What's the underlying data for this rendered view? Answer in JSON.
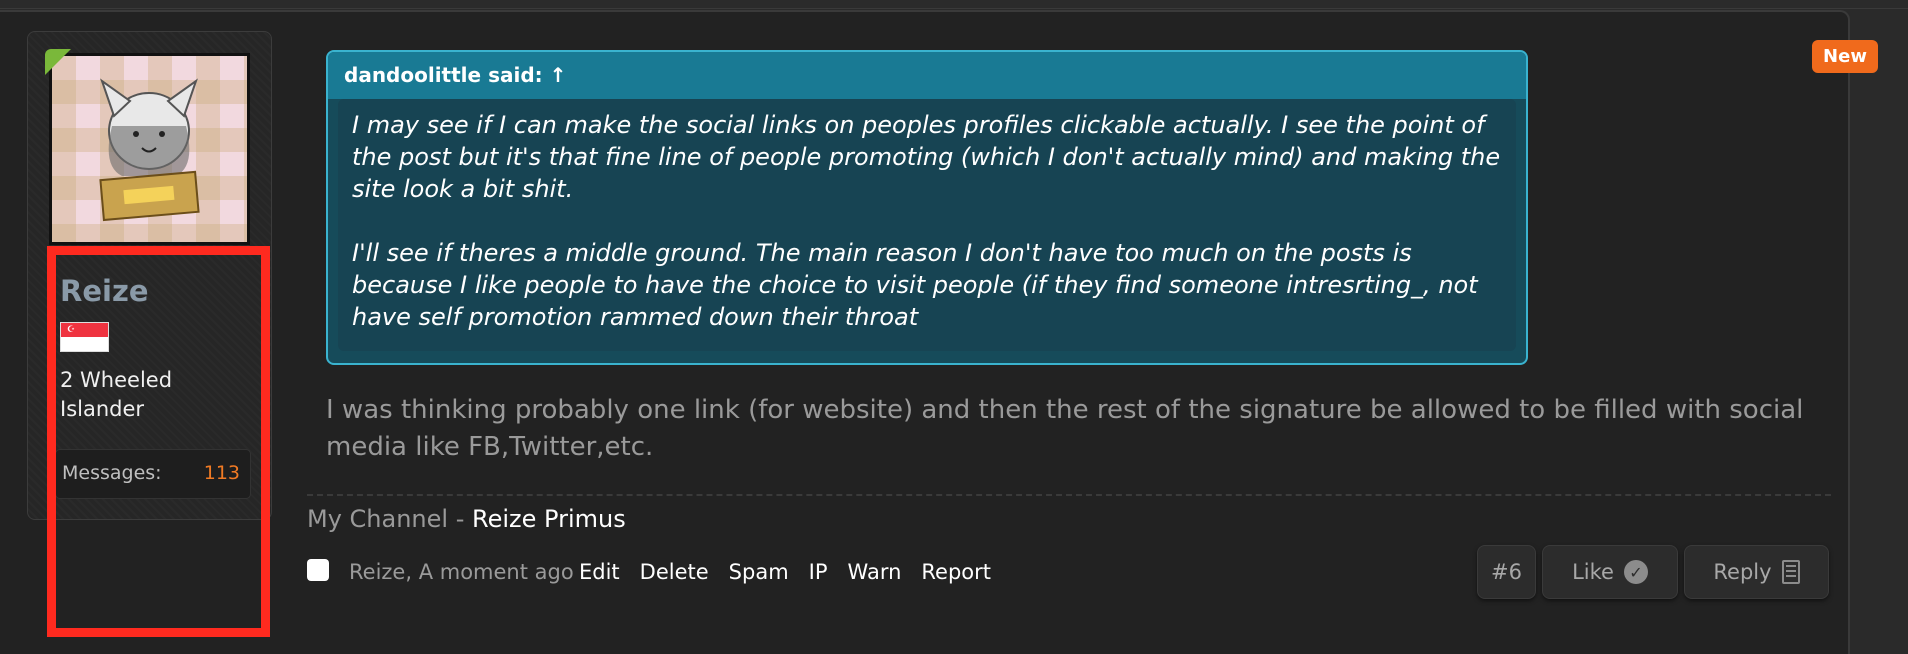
{
  "badge": {
    "new_label": "New"
  },
  "user": {
    "name": "Reize",
    "flag_icon": "singapore-flag-icon",
    "title": "2 Wheeled Islander",
    "stats": {
      "messages_label": "Messages:",
      "messages_value": "113"
    }
  },
  "quote": {
    "header": "dandoolittle said: ↑",
    "paragraphs": [
      "I may see if I can make the social links on peoples profiles clickable actually. I see the point of the post but it's that fine line of people promoting (which I don't actually mind) and making the site look a bit shit.",
      "I'll see if theres a middle ground. The main reason I don't have too much on the posts is because I like people to have the choice to visit people (if they find someone intresrting_, not have self promotion rammed down their throat"
    ]
  },
  "message": {
    "body": "I was thinking probably one link (for website) and then the rest of the signature be allowed to be filled with social media like FB,Twitter,etc."
  },
  "signature": {
    "prefix": "My Channel - ",
    "link": "Reize Primus"
  },
  "meta": {
    "author_time": "Reize, A moment ago"
  },
  "actions": {
    "edit": "Edit",
    "delete": "Delete",
    "spam": "Spam",
    "ip": "IP",
    "warn": "Warn",
    "report": "Report"
  },
  "buttons": {
    "post_number": "#6",
    "like": "Like",
    "reply": "Reply"
  },
  "colors": {
    "accent_orange": "#f06a1c",
    "quote_border": "#3ab3cf",
    "highlight_red": "#ff2a1f"
  }
}
